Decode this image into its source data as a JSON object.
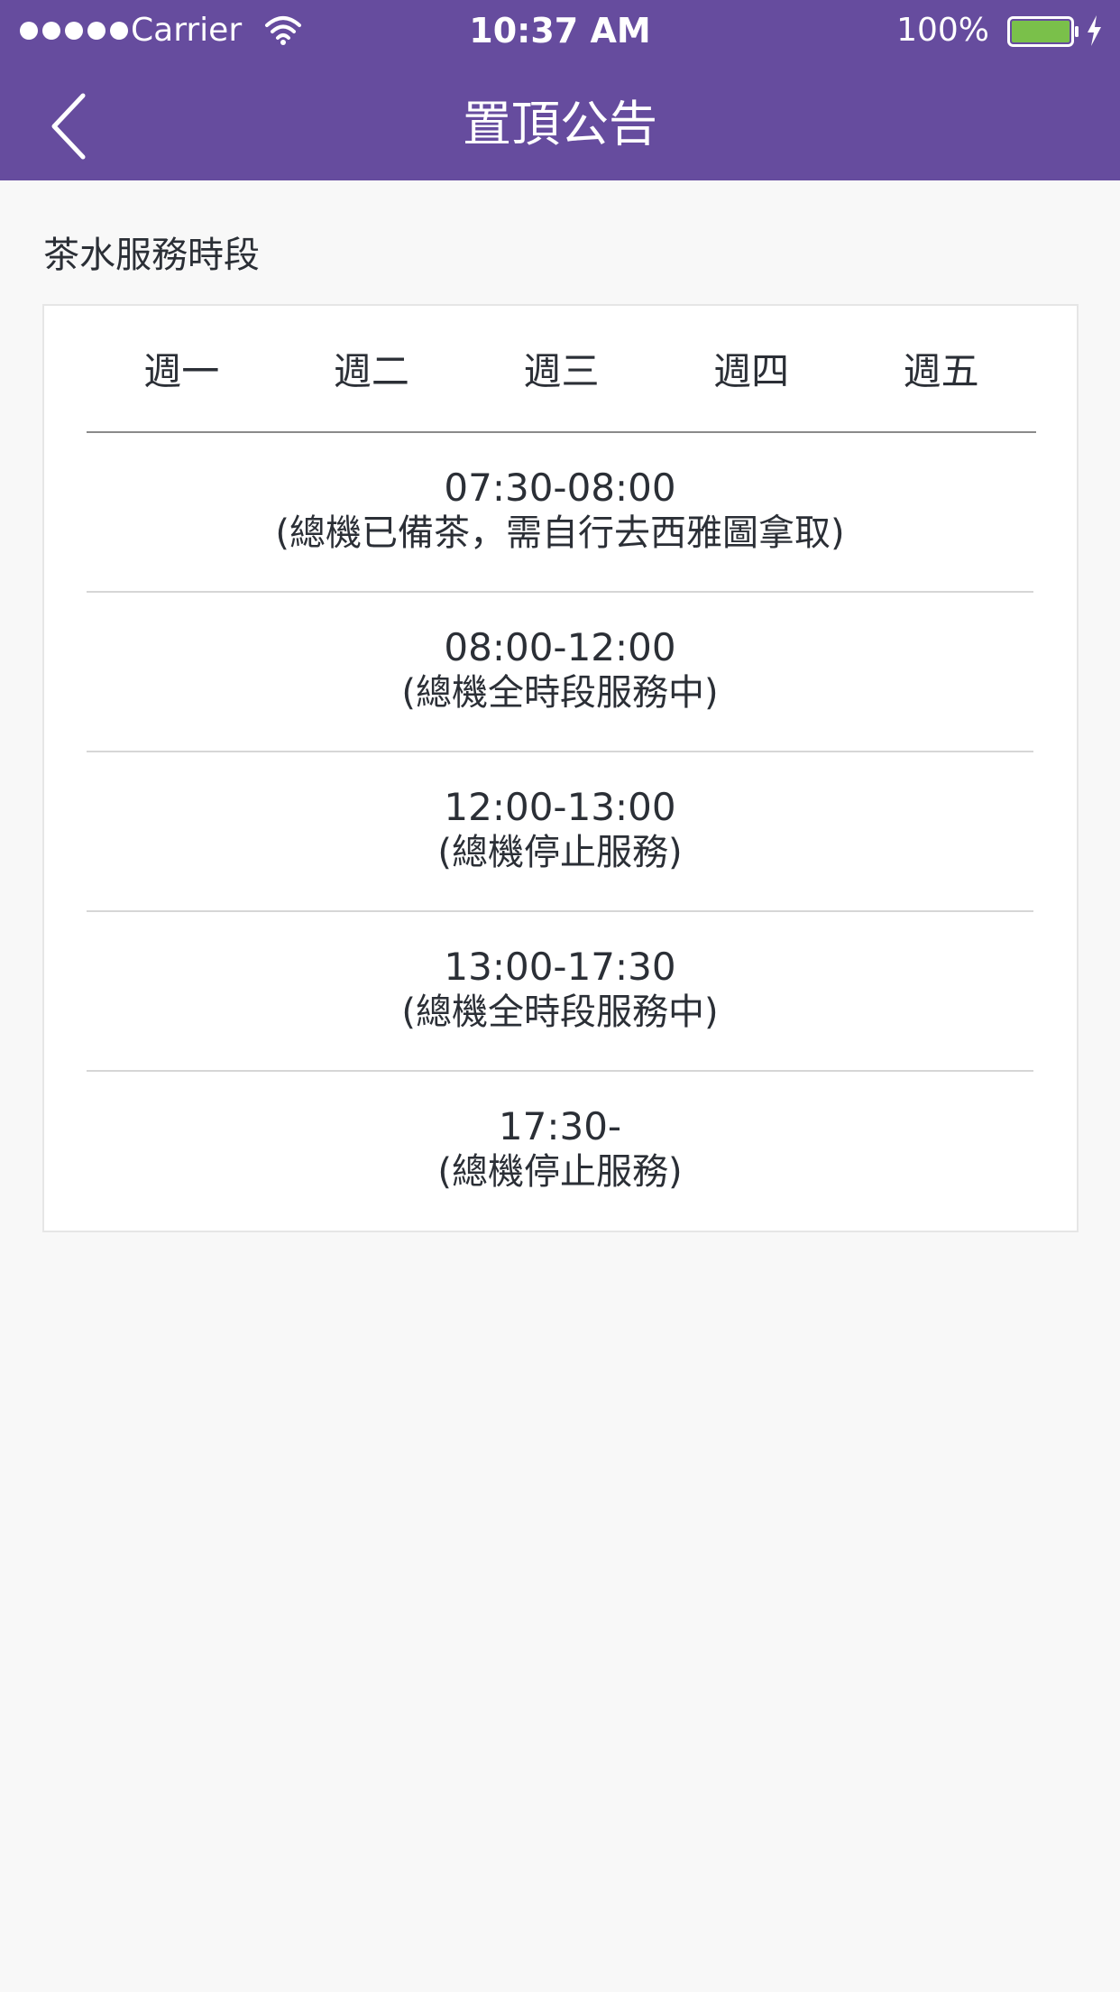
{
  "status_bar": {
    "carrier": "Carrier",
    "time": "10:37 AM",
    "battery": "100%"
  },
  "nav": {
    "title": "置頂公告",
    "back_icon": "chevron-left-icon"
  },
  "section": {
    "title": "茶水服務時段"
  },
  "schedule": {
    "days": [
      "週一",
      "週二",
      "週三",
      "週四",
      "週五"
    ],
    "slots": [
      {
        "time": "07:30-08:00",
        "note": "(總機已備茶，需自行去西雅圖拿取)"
      },
      {
        "time": "08:00-12:00",
        "note": "(總機全時段服務中)"
      },
      {
        "time": "12:00-13:00",
        "note": "(總機停止服務)"
      },
      {
        "time": "13:00-17:30",
        "note": "(總機全時段服務中)"
      },
      {
        "time": "17:30-",
        "note": "(總機停止服務)"
      }
    ]
  },
  "colors": {
    "header_bg": "#664c9e",
    "battery_fill": "#7ac04a",
    "text": "#2b2f36"
  }
}
